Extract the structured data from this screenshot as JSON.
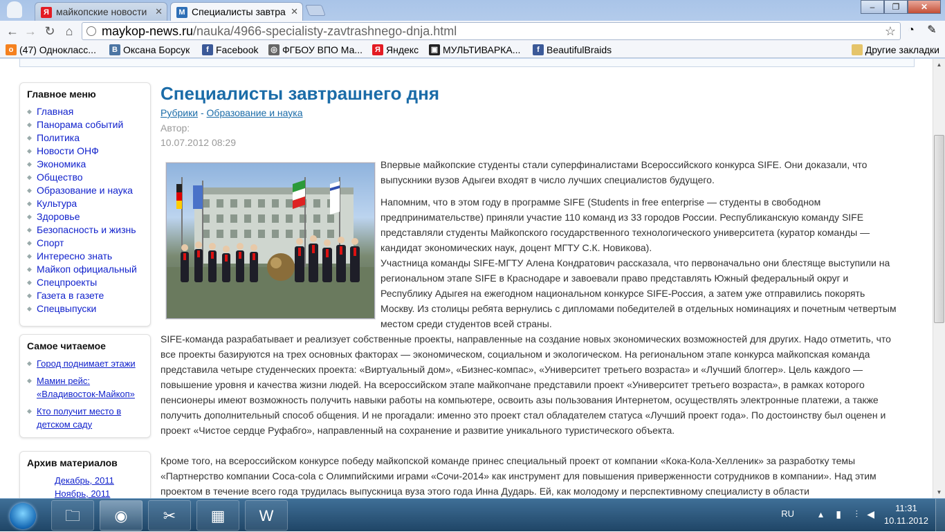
{
  "browser": {
    "tabs": [
      {
        "label": "майкопские новости",
        "icon": "yandex-icon"
      },
      {
        "label": "Специалисты завтра",
        "icon": "m-site-icon"
      }
    ],
    "address": {
      "host": "maykop-news.ru",
      "path": "/nauka/4966-specialisty-zavtrashnego-dnja.html"
    },
    "window_buttons": {
      "minimize": "–",
      "maximize": "❐",
      "close": "✕"
    },
    "bookmarks": [
      {
        "label": "(47) Однокласс...",
        "icon": "odnoklassniki-icon",
        "color": "#f5811f",
        "glyph": "о"
      },
      {
        "label": "Оксана Борсук",
        "icon": "vk-icon",
        "color": "#4c75a3",
        "glyph": "B"
      },
      {
        "label": "Facebook",
        "icon": "facebook-icon",
        "color": "#3b5998",
        "glyph": "f"
      },
      {
        "label": "ФГБОУ ВПО Ма...",
        "icon": "globe-icon",
        "color": "#666666",
        "glyph": "◎"
      },
      {
        "label": "Яндекс",
        "icon": "yandex-icon",
        "color": "#e31b23",
        "glyph": "Я"
      },
      {
        "label": "МУЛЬТИВАРКА...",
        "icon": "multivarka-icon",
        "color": "#222222",
        "glyph": "▣"
      },
      {
        "label": "BeautifulBraids",
        "icon": "facebook-icon",
        "color": "#3b5998",
        "glyph": "f"
      }
    ],
    "other_bookmarks": "Другие закладки"
  },
  "sidebar": {
    "main_menu": {
      "title": "Главное меню",
      "items": [
        "Главная",
        "Панорама событий",
        "Политика",
        "Новости ОНФ",
        "Экономика",
        "Общество",
        "Образование и наука",
        "Культура",
        "Здоровье",
        "Безопасность и жизнь",
        "Спорт",
        "Интересно знать",
        "Майкоп официальный",
        "Спецпроекты",
        "Газета в газете",
        "Спецвыпуски"
      ]
    },
    "popular": {
      "title": "Самое читаемое",
      "items": [
        "Город поднимает этажи",
        "Мамин рейс: «Владивосток-Майкоп»",
        "Кто получит место в детском саду"
      ]
    },
    "archive": {
      "title": "Архив материалов",
      "items": [
        "Декабрь, 2011",
        "Ноябрь, 2011"
      ]
    }
  },
  "article": {
    "title": "Специалисты завтрашнего дня",
    "category_root": "Рубрики",
    "category_sep": " - ",
    "category": "Образование и наука",
    "author_label": "Автор:",
    "date": "10.07.2012 08:29",
    "paragraphs": [
      "Впервые майкопские студенты стали суперфиналистами Всероссийского конкурса SIFE. Они доказали, что выпускники вузов Адыгеи входят в число лучших специалистов будущего.",
      "Напомним, что в этом году в программе SIFE (Students in free enterprise — студенты в свободном предпринимательстве) приняли участие 110 команд из 33 городов России. Республиканскую команду SIFE представляли студенты Майкопского государственного технологического университета (куратор команды — кандидат экономических наук, доцент МГТУ С.К. Новикова).",
      "Участница команды SIFE-МГТУ Алена Кондратович рассказала, что первоначально они блестяще выступили на региональном этапе SIFE в Краснодаре и завоевали право представлять Южный федеральный округ и Республику Адыгея на ежегодном национальном конкурсе SIFE-Россия, а затем уже отправились покорять Москву. Из столицы ребята вернулись с дипломами победителей в отдельных номинациях и почетным четвертым местом среди студентов всей страны.",
      "SIFE-команда разрабатывает и реализует собственные проекты, направленные на создание новых экономических возможностей для других. Надо отметить, что все проекты базируются на трех основных факторах — экономическом, социальном и экологическом. На региональном этапе конкурса майкопская команда представила четыре студенческих проекта: «Виртуальный дом», «Бизнес-компас», «Университет третьего возраста» и «Лучший блоггер». Цель каждого — повышение уровня и качества жизни людей. На всероссийском этапе майкопчане представили проект «Университет третьего возраста», в рамках которого пенсионеры имеют возможность получить навыки работы на компьютере, освоить азы пользования Интернетом, осуществлять электронные платежи, а также получить дополнительный способ общения. И не прогадали: именно это проект стал обладателем статуса «Лучший проект года». По достоинству был оценен и проект «Чистое сердце Руфабго», направленный на сохранение и развитие уникального туристического объекта.",
      "Кроме того, на всероссийском конкурсе победу майкопской команде принес специальный проект от компании «Кока-Кола-Хелленик» за разработку темы «Партнерство компании Coca-cola с Олимпийскими играми «Сочи-2014» как инструмент для повышения приверженности сотрудников в компании». Над этим проектом в течение всего года трудилась выпускница вуза этого года Инна Дударь. Ей, как молодому и перспективному специалисту в области"
    ]
  },
  "taskbar": {
    "apps": [
      "explorer-icon",
      "chrome-icon",
      "paint-icon",
      "calculator-icon",
      "word-icon"
    ],
    "lang": "RU",
    "time": "11:31",
    "date": "10.11.2012"
  }
}
